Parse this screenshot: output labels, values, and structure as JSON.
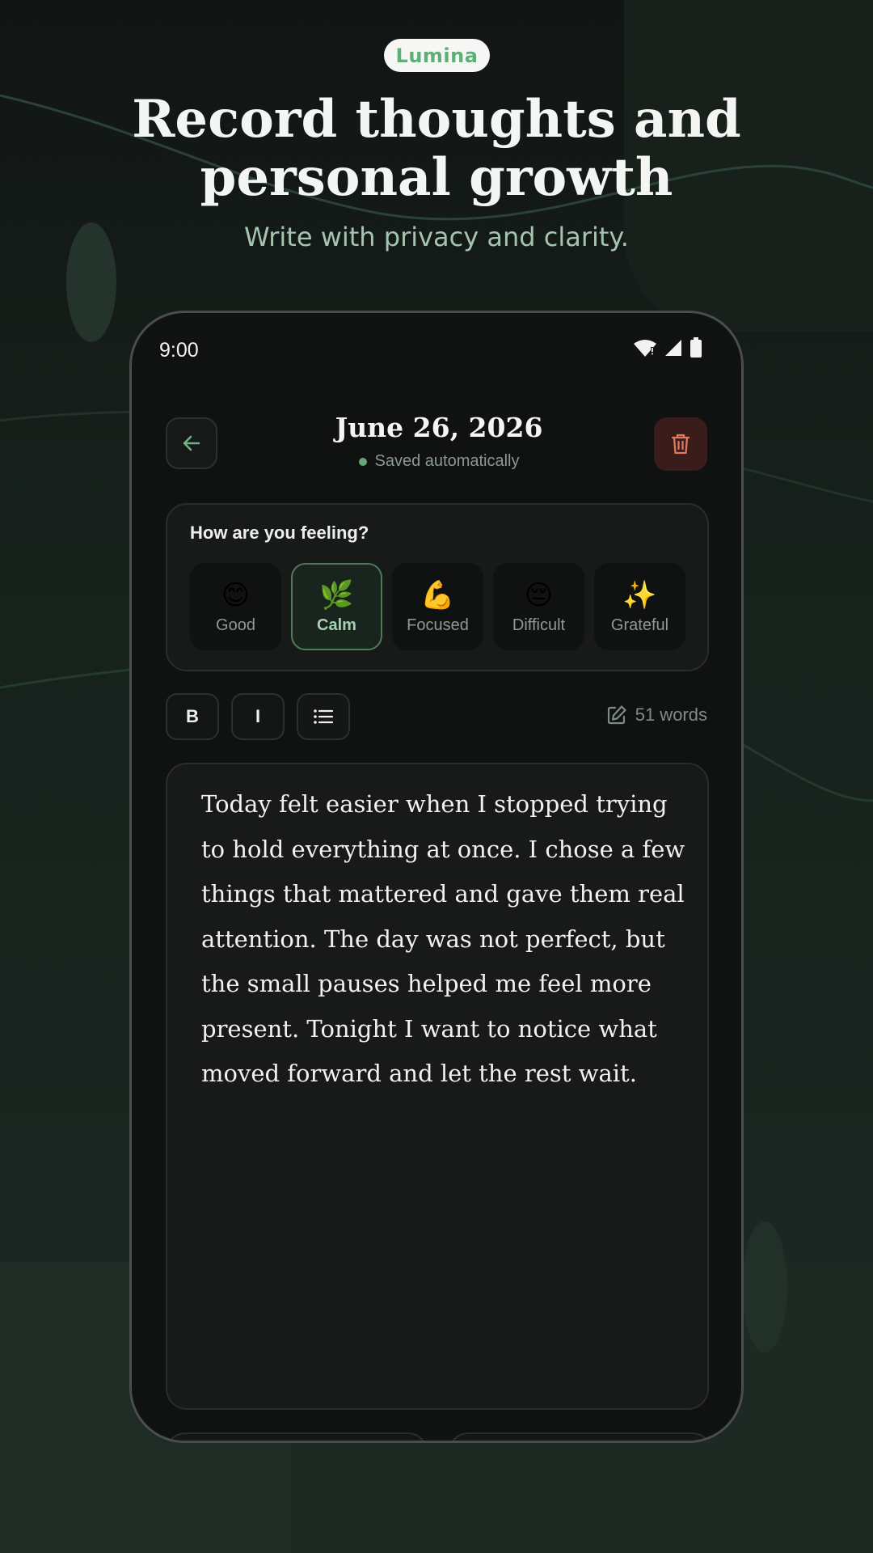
{
  "hero": {
    "badge": "Lumina",
    "title_line1": "Record thoughts and",
    "title_line2": "personal growth",
    "subtitle": "Write with privacy and clarity."
  },
  "status_bar": {
    "time": "9:00"
  },
  "header": {
    "date": "June 26, 2026",
    "save_status": "Saved automatically"
  },
  "mood": {
    "question": "How are you feeling?",
    "selected": "Calm",
    "options": [
      {
        "emoji": "😊",
        "label": "Good"
      },
      {
        "emoji": "🌿",
        "label": "Calm"
      },
      {
        "emoji": "💪",
        "label": "Focused"
      },
      {
        "emoji": "😔",
        "label": "Difficult"
      },
      {
        "emoji": "✨",
        "label": "Grateful"
      }
    ]
  },
  "toolbar": {
    "bold_label": "B",
    "italic_label": "I",
    "word_count": "51 words"
  },
  "entry": {
    "text": "Today felt easier when I stopped trying to hold everything at once. I chose a few things that mattered and gave them real attention. The day was not perfect, but the small pauses helped me feel more present. Tonight I want to notice what moved forward and let the rest wait."
  },
  "colors": {
    "accent": "#5fae78",
    "danger_bg": "#3a1d1b",
    "danger_icon": "#e07a5f",
    "background": "#111513"
  }
}
